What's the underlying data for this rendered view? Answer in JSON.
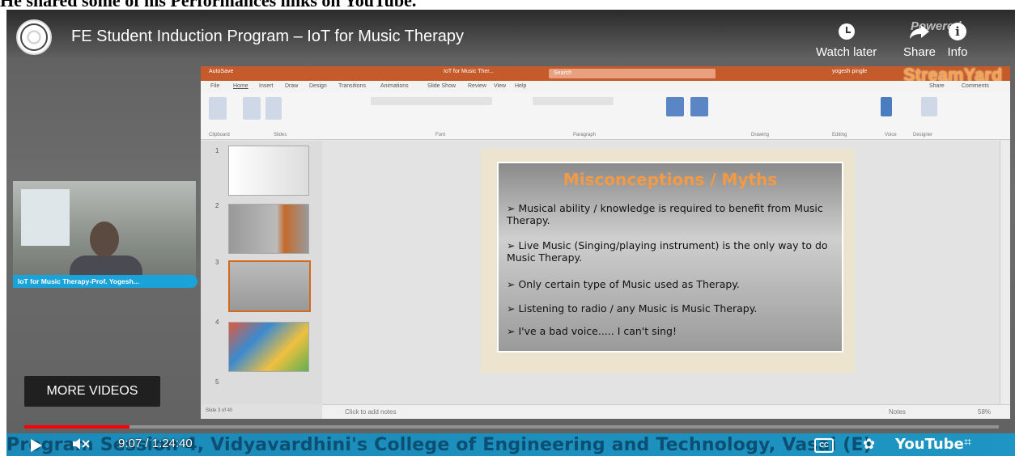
{
  "page_top_text": "He shared some of his Performances links on YouTube.",
  "player": {
    "title": "FE Student Induction Program – IoT for Music Therapy",
    "watch_later_label": "Watch later",
    "share_label": "Share",
    "info_label": "Info",
    "powered_label": "Powered",
    "more_videos_label": "MORE VIDEOS",
    "time": "9:07 / 1:24:40",
    "progress_fraction": 0.108,
    "youtube_label": "YouTube",
    "cc_label": "CC",
    "ticker": "Program Session 4, Vidyavardhini's College of Engineering and Technology, Vasai (E)"
  },
  "streamyard": "StreamYard",
  "webcam": {
    "label": "IoT for Music Therapy-Prof. Yogesh..."
  },
  "ppt": {
    "window_title": "IoT for Music Ther...",
    "autosave": "AutoSave",
    "search": "Search",
    "user": "yogesh pingle",
    "menu": [
      "File",
      "Home",
      "Insert",
      "Draw",
      "Design",
      "Transitions",
      "Animations",
      "Slide Show",
      "Review",
      "View",
      "Help"
    ],
    "share": "Share",
    "comments": "Comments",
    "groups": [
      "Clipboard",
      "Slides",
      "Font",
      "Paragraph",
      "Drawing",
      "Editing",
      "Voice",
      "Designer"
    ],
    "thumb_numbers": [
      "1",
      "2",
      "3",
      "4",
      "5"
    ],
    "notes_placeholder": "Click to add notes",
    "status": "Slide 3 of 40",
    "notes_btn": "Notes",
    "zoom": "58%",
    "slide": {
      "title": "Misconceptions / Myths",
      "bullets": [
        "Musical ability / knowledge is required to benefit from Music Therapy.",
        "Live Music (Singing/playing instrument) is the only way to do Music Therapy.",
        "Only certain type of Music used as Therapy.",
        "Listening to radio / any Music is Music Therapy.",
        "I've a bad voice..... I can't sing!"
      ]
    }
  },
  "colors": {
    "accent_orange": "#c55a2a",
    "progress_red": "#ff0000",
    "ticker_blue": "#1b8ab8",
    "camlabel_blue": "#1aa3d9"
  },
  "icons": [
    "channel-logo-icon",
    "clock-icon",
    "share-arrow-icon",
    "info-icon",
    "play-icon",
    "mute-icon",
    "cc-icon",
    "gear-icon",
    "exit-fullscreen-icon"
  ]
}
